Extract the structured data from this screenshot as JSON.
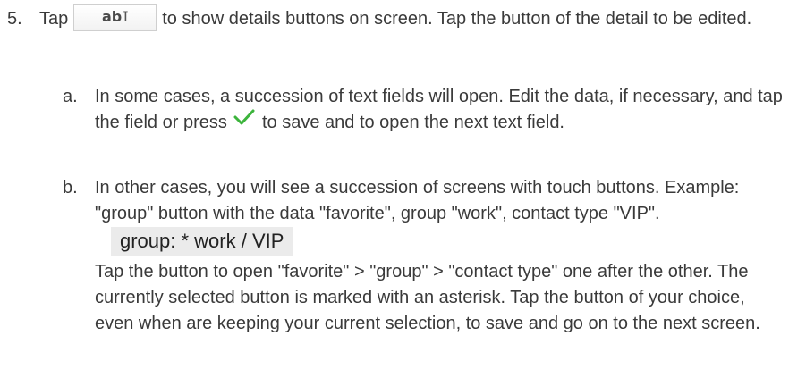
{
  "step5": {
    "number": "5.",
    "text_before_icon": "Tap",
    "icon_label": "ab",
    "icon_cursor": "I",
    "text_after_icon": "to show details buttons on screen.  Tap the button of the detail to be edited."
  },
  "sub_a": {
    "letter": "a.",
    "text_before_check": "In some cases, a succession of text fields will open.  Edit the data, if necessary, and tap the field or press",
    "text_after_check": "to save and to open the next text field."
  },
  "sub_b": {
    "letter": "b.",
    "text": "In other cases, you will see a succession of screens with touch buttons.  Example:  \"group\" button with the data \"favorite\", group \"work\", contact type \"VIP\".",
    "example_button": "group: * work / VIP",
    "paragraph2": "Tap the button to open \"favorite\" > \"group\" > \"contact type\" one after the other.  The currently selected button is marked with an asterisk.  Tap the button of your choice, even when are keeping your current selection, to save and go on to the next screen."
  },
  "colors": {
    "text": "#3a3a3a",
    "checkmark": "#3cb43c",
    "example_button_bg": "#ebebeb"
  }
}
